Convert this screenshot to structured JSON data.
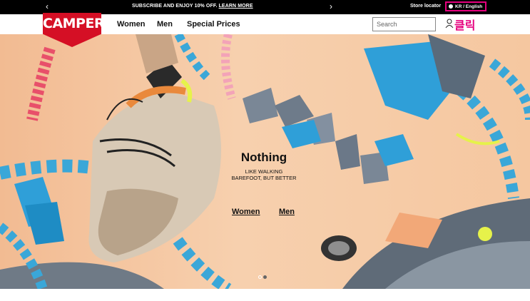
{
  "promo_bar": {
    "prev_arrow": "‹",
    "next_arrow": "›",
    "text": "SUBSCRIBE AND ENJOY 10% OFF.",
    "link": "LEARN MORE",
    "store_locator": "Store locator",
    "language": "KR / English"
  },
  "header": {
    "logo": "CAMPER",
    "nav": [
      "Women",
      "Men",
      "Special Prices"
    ],
    "search_placeholder": "Search",
    "annotation": "클릭"
  },
  "hero": {
    "title": "Nothing",
    "subtitle_line1": "LIKE WALKING",
    "subtitle_line2": "BAREFOOT, BUT BETTER",
    "links": [
      "Women",
      "Men"
    ],
    "slides": 2,
    "active_slide": 2
  },
  "colors": {
    "brand_red": "#d50f25",
    "annotation_pink": "#e6007e",
    "accent_blue": "#3aa7d8"
  }
}
